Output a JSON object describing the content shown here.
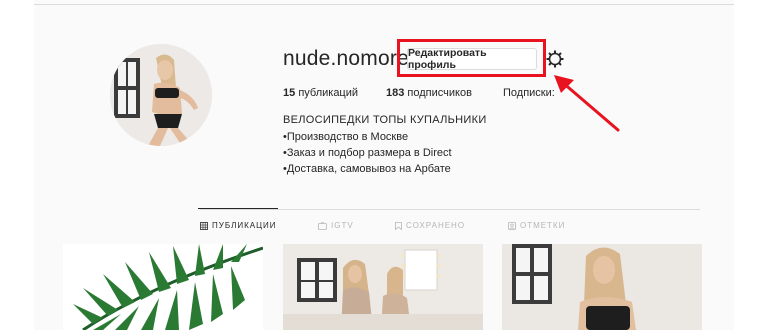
{
  "profile": {
    "username": "nude.nomore",
    "edit_button": "Редактировать профиль",
    "stats": {
      "posts_count": "15",
      "posts_label": "публикаций",
      "followers_count": "183",
      "followers_label": "подписчиков",
      "following_label": "Подписки:"
    },
    "bio": {
      "title": "ВЕЛОСИПЕДКИ ТОПЫ КУПАЛЬНИКИ",
      "lines": [
        "•Производство в Москве",
        "•Заказ и подбор размера в Direct",
        "•Доставка, самовывоз на Арбате"
      ]
    }
  },
  "tabs": [
    {
      "label": "ПУБЛИКАЦИИ",
      "icon": "grid-icon",
      "active": true
    },
    {
      "label": "IGTV",
      "icon": "tv-icon",
      "active": false
    },
    {
      "label": "СОХРАНЕНО",
      "icon": "bookmark-icon",
      "active": false
    },
    {
      "label": "ОТМЕТКИ",
      "icon": "tag-icon",
      "active": false
    }
  ],
  "colors": {
    "annotation_red": "#e8131f",
    "text": "#262626",
    "muted": "#b5b5b5",
    "border": "#dbdbdb"
  }
}
